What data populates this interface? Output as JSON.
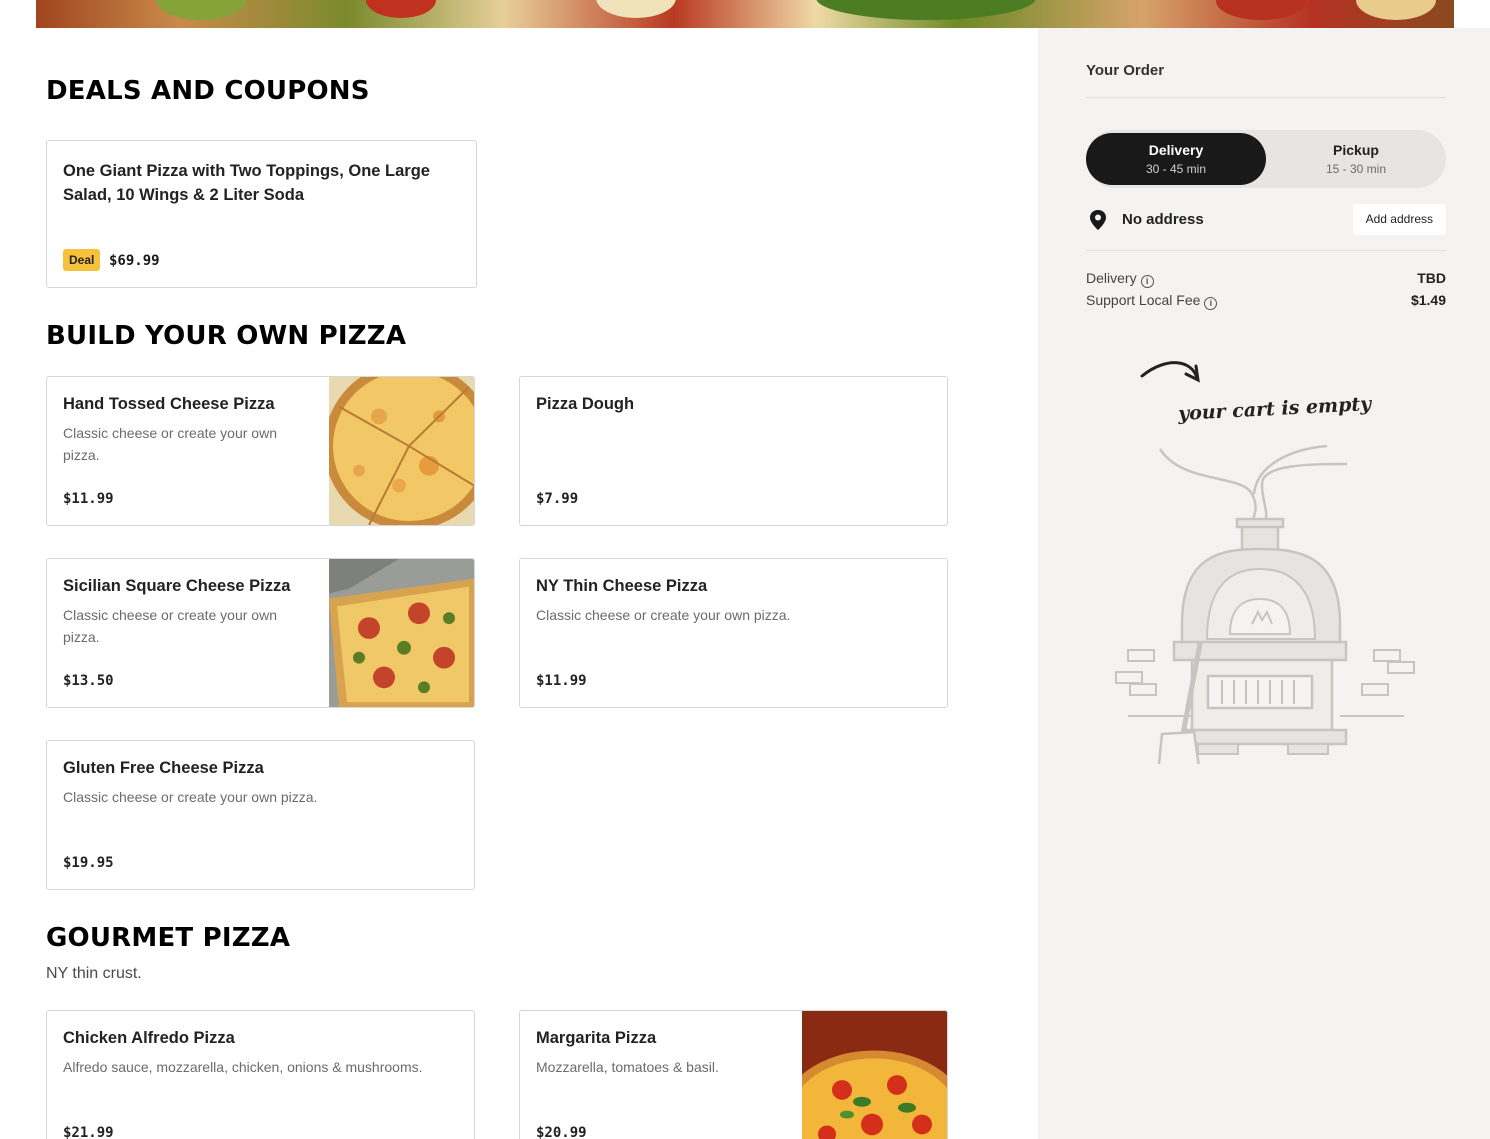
{
  "deals": {
    "title": "DEALS AND COUPONS",
    "items": [
      {
        "name": "One Giant Pizza with Two Toppings, One Large Salad, 10 Wings & 2 Liter Soda",
        "badge": "Deal",
        "price": "$69.99"
      }
    ]
  },
  "build_your_own": {
    "title": "BUILD YOUR OWN PIZZA",
    "items": [
      {
        "name": "Hand Tossed Cheese Pizza",
        "desc": "Classic cheese or create your own pizza.",
        "price": "$11.99",
        "image": "cheese-pizza-image"
      },
      {
        "name": "Pizza Dough",
        "desc": "",
        "price": "$7.99"
      },
      {
        "name": "Sicilian Square Cheese Pizza",
        "desc": "Classic cheese or create your own pizza.",
        "price": "$13.50",
        "image": "sicilian-pizza-image"
      },
      {
        "name": "NY Thin Cheese Pizza",
        "desc": "Classic cheese or create your own pizza.",
        "price": "$11.99"
      },
      {
        "name": "Gluten Free Cheese Pizza",
        "desc": "Classic cheese or create your own pizza.",
        "price": "$19.95"
      }
    ]
  },
  "gourmet": {
    "title": "GOURMET PIZZA",
    "subtitle": "NY thin crust.",
    "items": [
      {
        "name": "Chicken Alfredo Pizza",
        "desc": "Alfredo sauce, mozzarella, chicken, onions & mushrooms.",
        "price": "$21.99"
      },
      {
        "name": "Margarita Pizza",
        "desc": "Mozzarella, tomatoes & basil.",
        "price": "$20.99",
        "image": "margarita-pizza-image"
      }
    ]
  },
  "order": {
    "title": "Your Order",
    "modes": [
      {
        "label": "Delivery",
        "time": "30 - 45 min",
        "selected": true
      },
      {
        "label": "Pickup",
        "time": "15 - 30 min",
        "selected": false
      }
    ],
    "address": {
      "text": "No address",
      "button": "Add address",
      "icon": "location-pin-icon"
    },
    "fees": [
      {
        "label": "Delivery",
        "value": "TBD",
        "icon": "info-icon"
      },
      {
        "label": "Support Local Fee",
        "value": "$1.49",
        "icon": "info-icon"
      }
    ],
    "empty_message": "your cart is empty"
  },
  "colors": {
    "deal_badge": "#f7c23b",
    "panel_bg": "#f4f3f1",
    "active_toggle": "#191919"
  }
}
